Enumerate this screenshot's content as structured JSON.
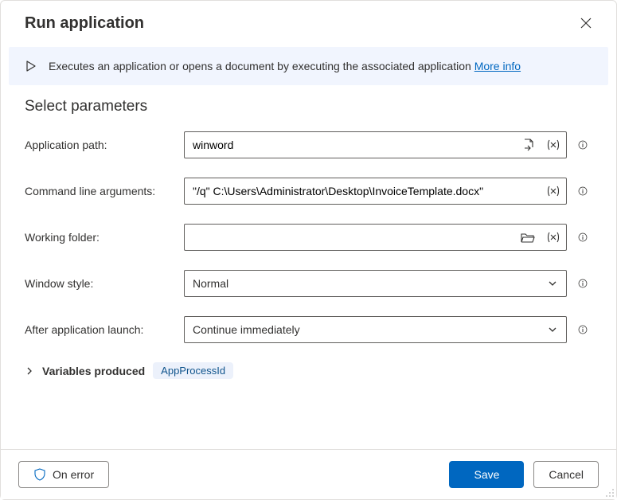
{
  "dialog": {
    "title": "Run application"
  },
  "banner": {
    "description": "Executes an application or opens a document by executing the associated application",
    "more_info_label": "More info"
  },
  "parameters": {
    "section_title": "Select parameters",
    "application_path": {
      "label": "Application path:",
      "value": "winword"
    },
    "command_line_arguments": {
      "label": "Command line arguments:",
      "value": "\"/q\" C:\\Users\\Administrator\\Desktop\\InvoiceTemplate.docx\""
    },
    "working_folder": {
      "label": "Working folder:",
      "value": ""
    },
    "window_style": {
      "label": "Window style:",
      "value": "Normal"
    },
    "after_application_launch": {
      "label": "After application launch:",
      "value": "Continue immediately"
    }
  },
  "variables_produced": {
    "label": "Variables produced",
    "items": [
      "AppProcessId"
    ]
  },
  "footer": {
    "on_error_label": "On error",
    "save_label": "Save",
    "cancel_label": "Cancel"
  }
}
